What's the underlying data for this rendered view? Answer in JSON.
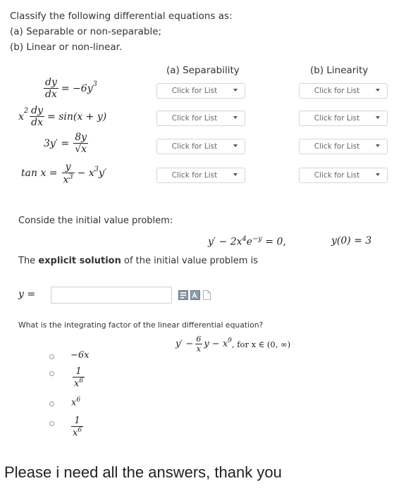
{
  "intro": {
    "line1": "Classify the following differential equations as:",
    "line2": "(a) Separable or non-separable;",
    "line3": "(b) Linear or non-linear."
  },
  "columns": {
    "separability": "(a) Separability",
    "linearity": "(b) Linearity"
  },
  "equations": {
    "e1": {
      "num": "dy",
      "den": "dx",
      "rhs": "= −6y",
      "exp": "3"
    },
    "e2": {
      "lead": "x",
      "lead_exp": "2",
      "num": "dy",
      "den": "dx",
      "rhs": "= sin(x + y)"
    },
    "e3": {
      "lhs": "3y′ =",
      "num": "8y",
      "den": "√x"
    },
    "e4": {
      "lhs": "tan x =",
      "num": "y",
      "den": "x",
      "den_exp": "3",
      "tail": "− x",
      "tail_exp": "3",
      "tail_end": "y′"
    }
  },
  "dropdown_label": "Click for List",
  "ivp": {
    "prompt": "Conside the initial value problem:",
    "eq_a": "y′ − 2x",
    "eq_a_exp": "4",
    "eq_b": "e",
    "eq_b_exp": "−y",
    "eq_c": "= 0,",
    "cond": "y(0) = 3",
    "explicit_pre": "The ",
    "explicit_bold": "explicit solution",
    "explicit_post": " of the initial value problem is",
    "y_label": "y ="
  },
  "integrating": {
    "question": "What is the integrating factor of the linear differential equation?",
    "eq_pre": "y′ −",
    "eq_num": "6",
    "eq_den": "x",
    "eq_mid": "y − x",
    "eq_exp": "9",
    "eq_post": ", for x ∈ (0, ∞)",
    "options": [
      {
        "text": "−6x"
      },
      {
        "num": "1",
        "den": "x",
        "den_exp": "6"
      },
      {
        "base": "x",
        "exp": "6"
      },
      {
        "num": "1",
        "den": "x",
        "den_exp": "6"
      }
    ]
  },
  "footer": "Please i need all the answers, thank you",
  "colors": {
    "text": "#333333",
    "border": "#d5d5d5",
    "bg": "#ffffff"
  },
  "icons": [
    "equation-editor-icon",
    "math-editor-icon",
    "document-icon",
    "caret-down-icon",
    "radio-icon"
  ]
}
